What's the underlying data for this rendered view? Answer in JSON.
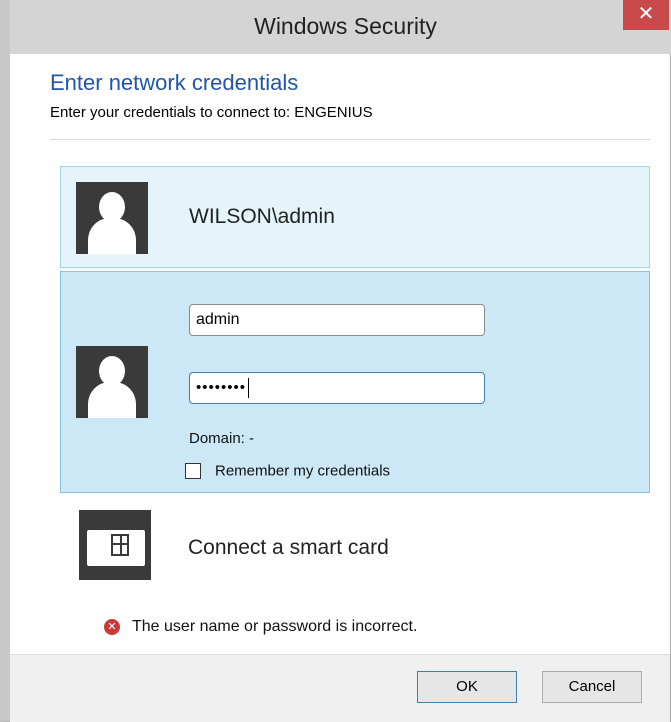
{
  "window": {
    "title": "Windows Security",
    "close_glyph": "✕"
  },
  "header": {
    "heading": "Enter network credentials",
    "subheading": "Enter your credentials to connect to: ENGENIUS"
  },
  "saved_credential": {
    "name": "WILSON\\admin",
    "icon": "user-avatar-icon"
  },
  "active_credential": {
    "username": "admin",
    "password_mask": "••••••••",
    "domain_label": "Domain: -",
    "remember_label": "Remember my credentials",
    "remember_checked": false,
    "icon": "user-avatar-icon"
  },
  "smartcard": {
    "label": "Connect a smart card",
    "icon": "smart-card-icon"
  },
  "error": {
    "message": "The user name or password is incorrect.",
    "glyph": "✕",
    "icon": "error-icon"
  },
  "footer": {
    "ok_label": "OK",
    "cancel_label": "Cancel"
  },
  "colors": {
    "heading": "#1f56a8",
    "tile_saved_bg": "#e5f3fb",
    "tile_active_bg": "#cce8f7",
    "close_button": "#c84a4a",
    "error_icon": "#c83a3a"
  }
}
